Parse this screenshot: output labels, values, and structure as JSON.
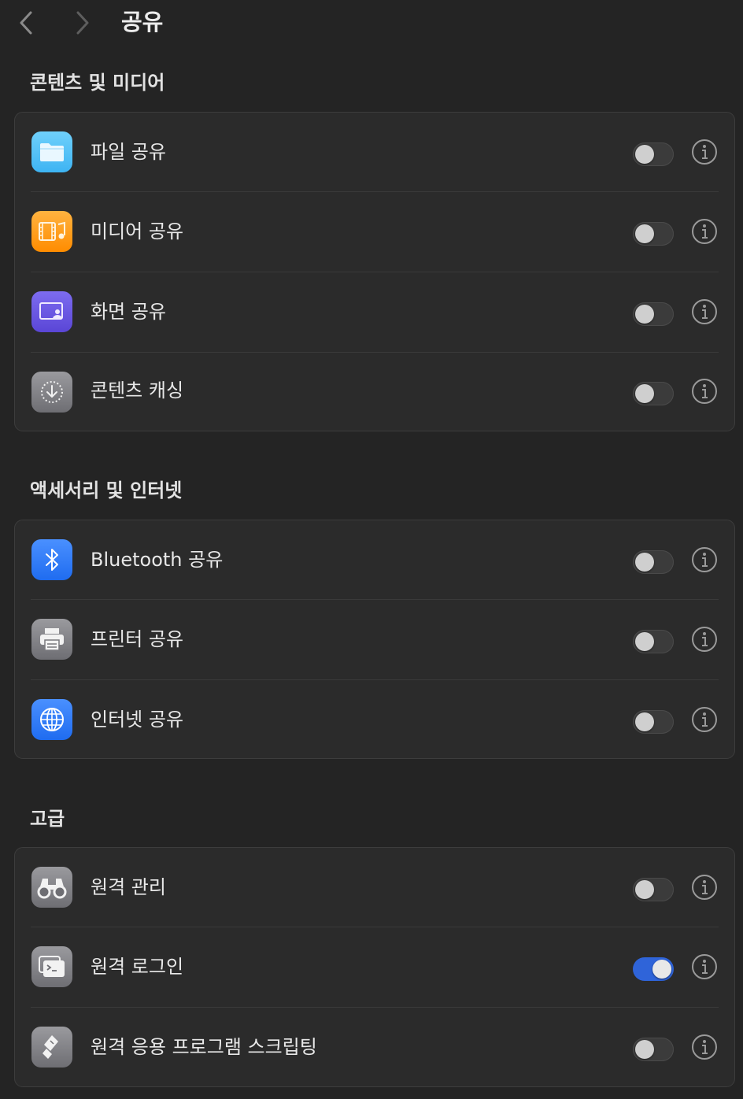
{
  "toolbar": {
    "back_icon": "chevron-left-icon",
    "forward_icon": "chevron-right-icon",
    "title": "공유"
  },
  "sections": [
    {
      "title": "콘텐츠 및 미디어",
      "items": [
        {
          "label": "파일 공유",
          "icon": "folder-icon",
          "enabled": false
        },
        {
          "label": "미디어 공유",
          "icon": "media-icon",
          "enabled": false
        },
        {
          "label": "화면 공유",
          "icon": "screen-share-icon",
          "enabled": false
        },
        {
          "label": "콘텐츠 캐싱",
          "icon": "content-caching-icon",
          "enabled": false
        }
      ]
    },
    {
      "title": "액세서리 및 인터넷",
      "items": [
        {
          "label": "Bluetooth 공유",
          "icon": "bluetooth-icon",
          "enabled": false
        },
        {
          "label": "프린터 공유",
          "icon": "printer-icon",
          "enabled": false
        },
        {
          "label": "인터넷 공유",
          "icon": "globe-icon",
          "enabled": false
        }
      ]
    },
    {
      "title": "고급",
      "items": [
        {
          "label": "원격 관리",
          "icon": "binoculars-icon",
          "enabled": false
        },
        {
          "label": "원격 로그인",
          "icon": "terminal-icon",
          "enabled": true
        },
        {
          "label": "원격 응용 프로그램 스크립팅",
          "icon": "script-icon",
          "enabled": false
        }
      ]
    }
  ],
  "colors": {
    "background": "#242424",
    "group_background": "#2b2b2b",
    "toggle_on": "#2f64d9",
    "toggle_off": "#3b3b3b",
    "folder_icon": "#5ac8fa",
    "media_icon": "#ff9f0a",
    "screen_share_icon": "#6e5ce6",
    "bluetooth_icon": "#2f7cf6",
    "globe_icon": "#2f7cf6",
    "gray_icon": "#8e8e93"
  }
}
